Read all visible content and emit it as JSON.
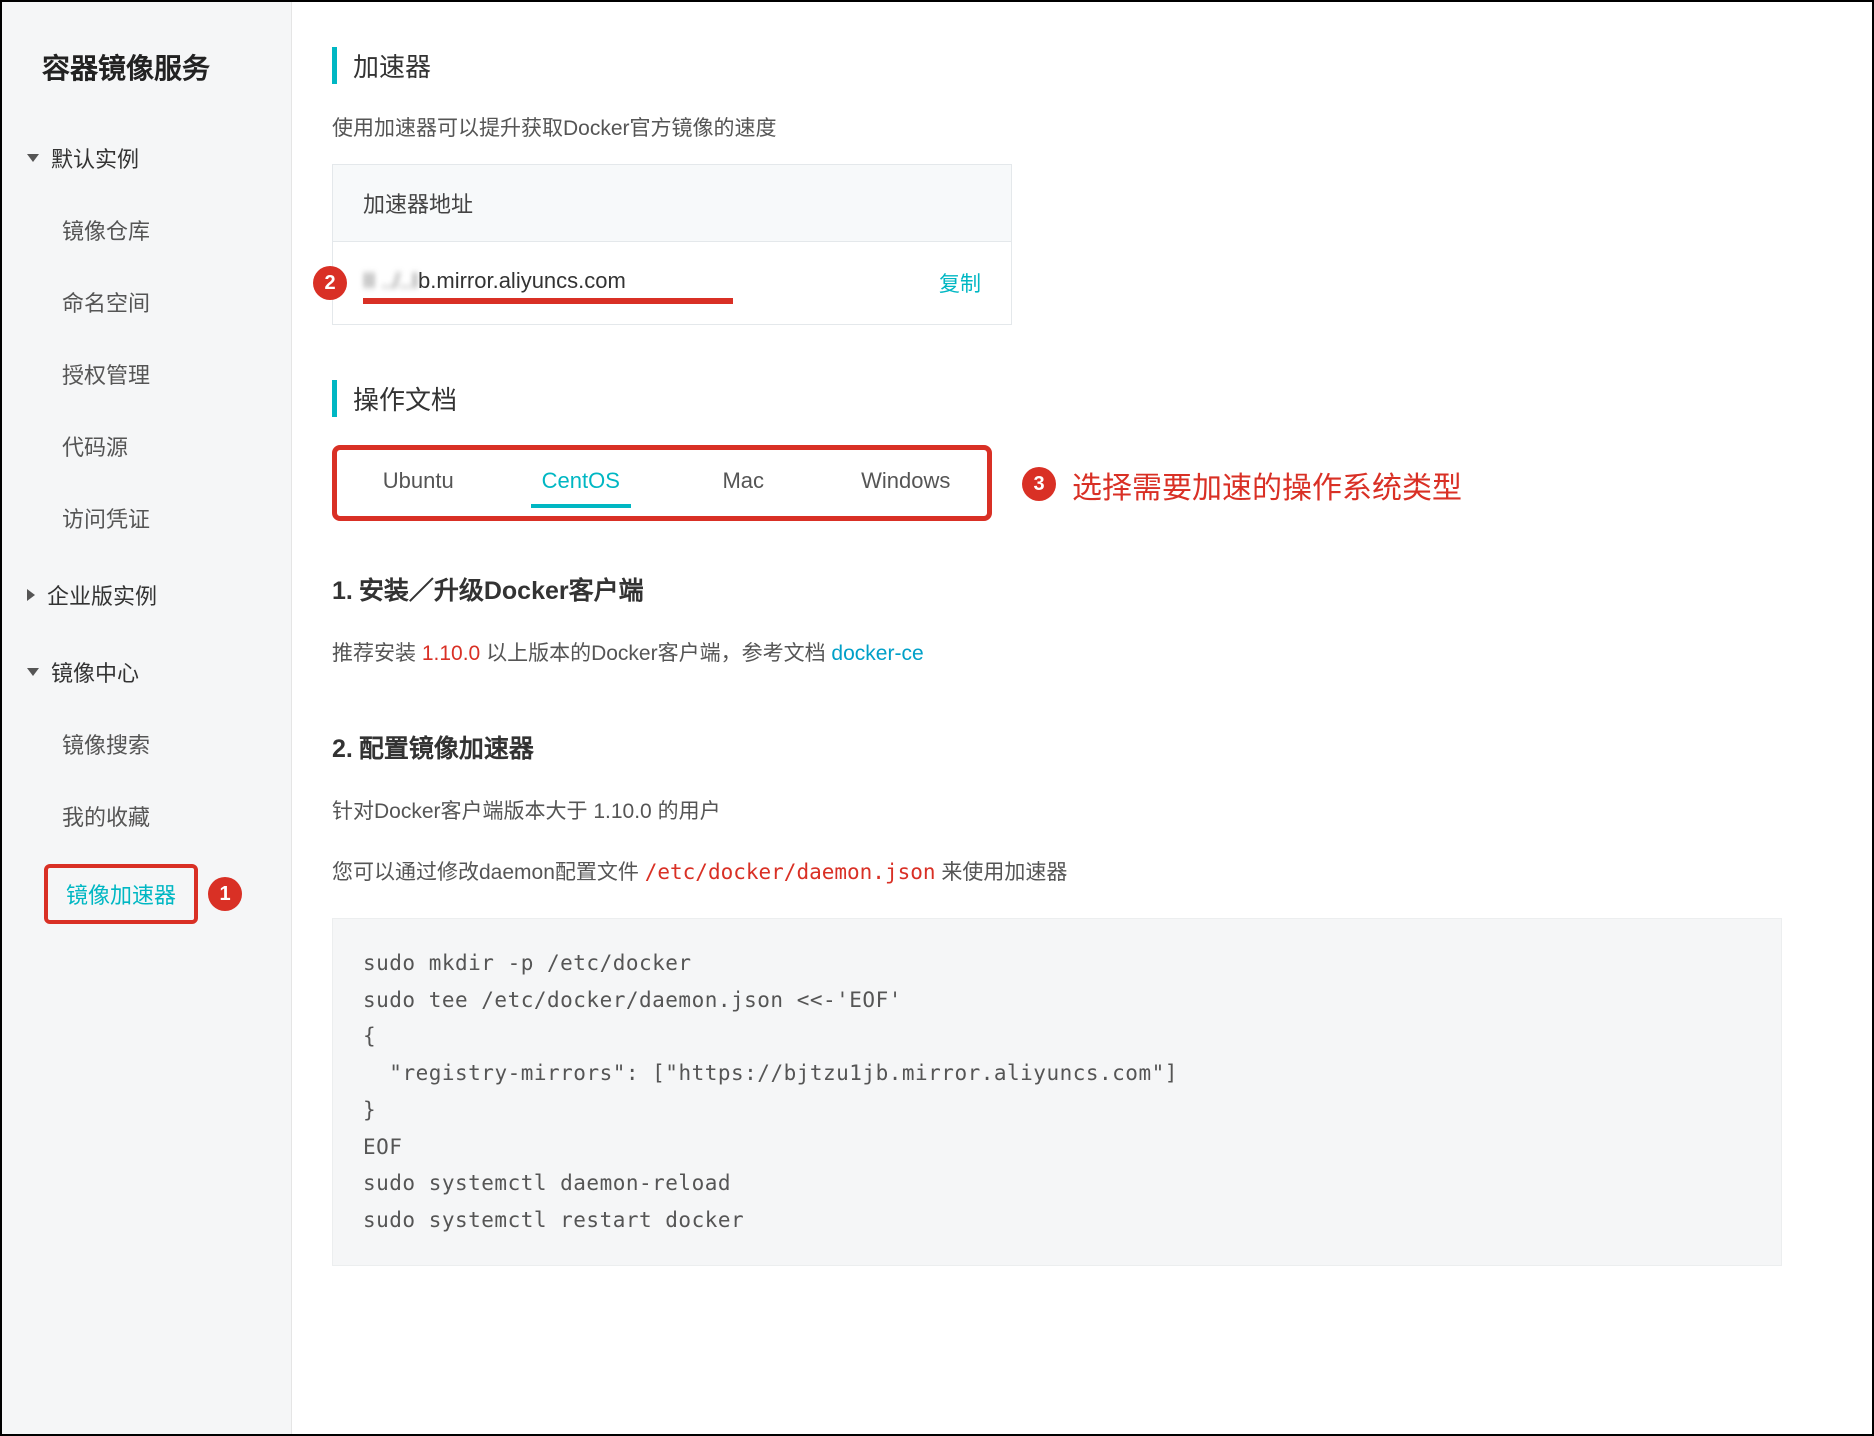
{
  "sidebar": {
    "title": "容器镜像服务",
    "groups": [
      {
        "label": "默认实例",
        "open": true,
        "items": [
          "镜像仓库",
          "命名空间",
          "授权管理",
          "代码源",
          "访问凭证"
        ]
      },
      {
        "label": "企业版实例",
        "open": false,
        "items": []
      },
      {
        "label": "镜像中心",
        "open": true,
        "items": [
          "镜像搜索",
          "我的收藏",
          "镜像加速器"
        ],
        "active_index": 2
      }
    ]
  },
  "main": {
    "accel": {
      "header": "加速器",
      "desc": "使用加速器可以提升获取Docker官方镜像的速度",
      "card_header": "加速器地址",
      "addr_blurred": "II ../..I",
      "addr_suffix": "b.mirror.aliyuncs.com",
      "copy_label": "复制"
    },
    "docs_header": "操作文档",
    "tabs": [
      "Ubuntu",
      "CentOS",
      "Mac",
      "Windows"
    ],
    "active_tab": 1,
    "section1": {
      "title_num": "1.",
      "title": "安装／升级Docker客户端",
      "para_prefix": "推荐安装 ",
      "version": "1.10.0",
      "para_mid": " 以上版本的Docker客户端，参考文档 ",
      "link": "docker-ce"
    },
    "section2": {
      "title_num": "2.",
      "title": "配置镜像加速器",
      "para1": "针对Docker客户端版本大于 1.10.0 的用户",
      "para2_prefix": "您可以通过修改daemon配置文件 ",
      "para2_path": "/etc/docker/daemon.json",
      "para2_suffix": " 来使用加速器",
      "code": "sudo mkdir -p /etc/docker\nsudo tee /etc/docker/daemon.json <<-'EOF'\n{\n  \"registry-mirrors\": [\"https://bjtzu1jb.mirror.aliyuncs.com\"]\n}\nEOF\nsudo systemctl daemon-reload\nsudo systemctl restart docker"
    }
  },
  "annotations": {
    "circle1": "1",
    "circle2": "2",
    "circle3": "3",
    "text3": "选择需要加速的操作系统类型"
  }
}
